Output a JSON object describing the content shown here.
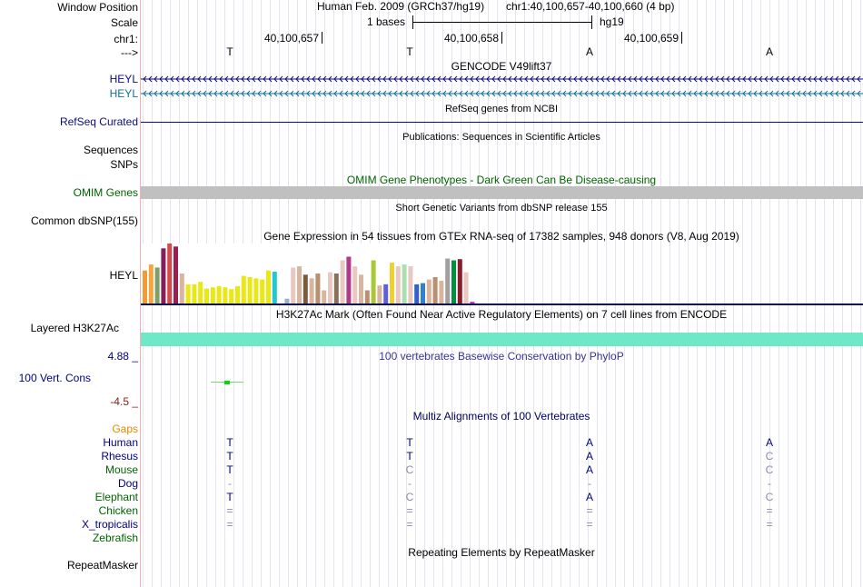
{
  "header": {
    "window_position_label": "Window Position",
    "assembly": "Human Feb. 2009 (GRCh37/hg19)",
    "position": "chr1:40,100,657-40,100,660 (4 bp)",
    "scale_label": "Scale",
    "scale_text": "1 bases",
    "db": "hg19",
    "chrom_label": "chr1:",
    "ticks": [
      "40,100,657",
      "40,100,658",
      "40,100,659"
    ],
    "strand_label": "--->",
    "ref_bases": [
      "T",
      "T",
      "A",
      "A"
    ]
  },
  "tracks": {
    "gencode": {
      "title": "GENCODE V49lift37",
      "labels": [
        "HEYL",
        "HEYL"
      ]
    },
    "refseq": {
      "title": "RefSeq genes from NCBI",
      "label": "RefSeq Curated"
    },
    "publications": {
      "title": "Publications: Sequences in Scientific Articles",
      "label": "Sequences"
    },
    "snps_label": "SNPs",
    "omim": {
      "title": "OMIM Gene Phenotypes - Dark Green Can Be Disease-causing",
      "label": "OMIM Genes"
    },
    "dbsnp": {
      "title": "Short Genetic Variants from dbSNP release 155",
      "label": "Common dbSNP(155)"
    },
    "gtex": {
      "title": "Gene Expression in 54 tissues from GTEx RNA-seq of 17382 samples, 948 donors (V8, Aug 2019)",
      "label": "HEYL"
    },
    "h3k27ac": {
      "title": "H3K27Ac Mark (Often Found Near Active Regulatory Elements) on 7 cell lines from ENCODE",
      "label": "Layered H3K27Ac"
    },
    "phylop": {
      "title": "100 vertebrates Basewise Conservation by PhyloP",
      "label": "100 Vert. Cons",
      "max": "4.88 _",
      "min": "-4.5 _"
    },
    "multiz": {
      "title": "Multiz Alignments of 100 Vertebrates",
      "gaps_label": "Gaps",
      "species": [
        {
          "name": "Human",
          "color": "#000080",
          "bases": [
            "T",
            "T",
            "A",
            "A"
          ]
        },
        {
          "name": "Rhesus",
          "color": "#000080",
          "bases": [
            "T",
            "T",
            "A",
            "C"
          ]
        },
        {
          "name": "Mouse",
          "color": "#006400",
          "bases": [
            "T",
            "C",
            "A",
            "C"
          ]
        },
        {
          "name": "Dog",
          "color": "#000080",
          "bases": [
            "-",
            "-",
            "-",
            "-"
          ]
        },
        {
          "name": "Elephant",
          "color": "#006400",
          "bases": [
            "T",
            "C",
            "A",
            "C"
          ]
        },
        {
          "name": "Chicken",
          "color": "#006400",
          "bases": [
            "=",
            "=",
            "=",
            "="
          ]
        },
        {
          "name": "X_tropicalis",
          "color": "#000080",
          "bases": [
            "=",
            "=",
            "=",
            "="
          ]
        },
        {
          "name": "Zebrafish",
          "color": "#006400",
          "bases": [
            "",
            "",
            "",
            ""
          ]
        }
      ]
    },
    "repeatmasker": {
      "title": "Repeating Elements by RepeatMasker",
      "label": "RepeatMasker"
    }
  },
  "colors": {
    "gene": "#0c0c78",
    "gene2": "#146e9a",
    "omim": "#c0c0c0",
    "h3k27ac": "#6fe8c8",
    "phylop_green": "#00dd00",
    "gaps": "#e08a00",
    "navy": "#000080",
    "darkgreen": "#006400",
    "darkred": "#8b1a1a"
  },
  "gtex_bars": [
    {
      "v": 0.55,
      "c": "#f39b33"
    },
    {
      "v": 0.65,
      "c": "#f5a440"
    },
    {
      "v": 0.6,
      "c": "#7f9f6a"
    },
    {
      "v": 0.92,
      "c": "#8a1c5a"
    },
    {
      "v": 1.0,
      "c": "#d44a4a"
    },
    {
      "v": 0.95,
      "c": "#9a1f4e"
    },
    {
      "v": 0.5,
      "c": "#d9b5a0"
    },
    {
      "v": 0.32,
      "c": "#e8e817"
    },
    {
      "v": 0.32,
      "c": "#e8e817"
    },
    {
      "v": 0.36,
      "c": "#e8e817"
    },
    {
      "v": 0.25,
      "c": "#e8e817"
    },
    {
      "v": 0.27,
      "c": "#e8e817"
    },
    {
      "v": 0.29,
      "c": "#e8e817"
    },
    {
      "v": 0.27,
      "c": "#e8e817"
    },
    {
      "v": 0.24,
      "c": "#e8e817"
    },
    {
      "v": 0.29,
      "c": "#e8e817"
    },
    {
      "v": 0.46,
      "c": "#e8e817"
    },
    {
      "v": 0.44,
      "c": "#e8e817"
    },
    {
      "v": 0.42,
      "c": "#e8e817"
    },
    {
      "v": 0.4,
      "c": "#e8e817"
    },
    {
      "v": 0.55,
      "c": "#e8e817"
    },
    {
      "v": 0.53,
      "c": "#20c8d0"
    },
    {
      "v": 0.0,
      "c": "#ffffff"
    },
    {
      "v": 0.08,
      "c": "#9ab0d8"
    },
    {
      "v": 0.6,
      "c": "#e8c8c0"
    },
    {
      "v": 0.62,
      "c": "#d9b5a0"
    },
    {
      "v": 0.48,
      "c": "#7a5b3e"
    },
    {
      "v": 0.42,
      "c": "#d9b5a0"
    },
    {
      "v": 0.5,
      "c": "#b89070"
    },
    {
      "v": 0.22,
      "c": "#d9b5a0"
    },
    {
      "v": 0.52,
      "c": "#e8c8c0"
    },
    {
      "v": 0.5,
      "c": "#8a7058"
    },
    {
      "v": 0.72,
      "c": "#e8c8c0"
    },
    {
      "v": 0.78,
      "c": "#b03a8a"
    },
    {
      "v": 0.62,
      "c": "#e8c8c0"
    },
    {
      "v": 0.48,
      "c": "#d9b5a0"
    },
    {
      "v": 0.22,
      "c": "#b89070"
    },
    {
      "v": 0.72,
      "c": "#a8c838"
    },
    {
      "v": 0.3,
      "c": "#d9b5a0"
    },
    {
      "v": 0.32,
      "c": "#6060d8"
    },
    {
      "v": 0.68,
      "c": "#f0d030"
    },
    {
      "v": 0.62,
      "c": "#e8c8c0"
    },
    {
      "v": 0.65,
      "c": "#a8e0b0"
    },
    {
      "v": 0.62,
      "c": "#e8c8c0"
    },
    {
      "v": 0.32,
      "c": "#3060d0"
    },
    {
      "v": 0.34,
      "c": "#3080d0"
    },
    {
      "v": 0.4,
      "c": "#d9b5a0"
    },
    {
      "v": 0.44,
      "c": "#b89070"
    },
    {
      "v": 0.38,
      "c": "#d9b5a0"
    },
    {
      "v": 0.75,
      "c": "#a0a0a0"
    },
    {
      "v": 0.72,
      "c": "#009040"
    },
    {
      "v": 0.74,
      "c": "#8a1c2a"
    },
    {
      "v": 0.52,
      "c": "#e8c8c0"
    },
    {
      "v": 0.03,
      "c": "#c040c0"
    }
  ]
}
